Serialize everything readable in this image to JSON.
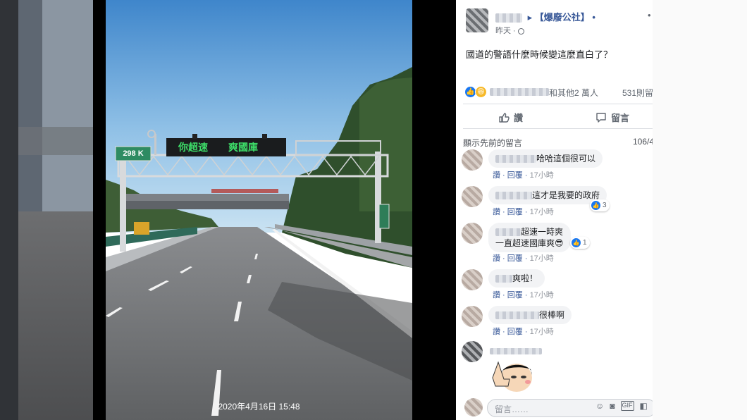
{
  "photo": {
    "sign_message_left": "你超速",
    "sign_message_right": "爽國庫",
    "km_marker": "298 K",
    "timestamp": "2020年4月16日 15:48"
  },
  "post": {
    "group_name": "▸ 【爆廢公社】 •",
    "time": "昨天 · ",
    "more": "•",
    "text": "國道的警語什麼時候變這麼直白了？",
    "reactions_suffix": "和其他2 萬人",
    "comment_count": "531則留",
    "like_label": "讚",
    "comment_label": "留言"
  },
  "comments_section": {
    "show_previous": "顯示先前的留言",
    "count": "106/4",
    "like_action": "讚",
    "reply_action": "回覆",
    "time": "17小時",
    "items": [
      {
        "text": "哈哈這個很可以",
        "reaction_count": ""
      },
      {
        "text": "這才是我要的政府",
        "reaction_count": "3"
      },
      {
        "text": "超速一時爽",
        "text2": "一直超速國庫爽😎",
        "reaction_count": "1"
      },
      {
        "text": "爽啦！",
        "reaction_count": ""
      },
      {
        "text": "很棒啊",
        "reaction_count": ""
      }
    ]
  },
  "composer": {
    "placeholder": "留言……"
  },
  "colors": {
    "sky_top": "#4b8fcf",
    "sign_green": "#3ee06a",
    "fb_blue": "#1877f2",
    "link_blue": "#385898"
  }
}
